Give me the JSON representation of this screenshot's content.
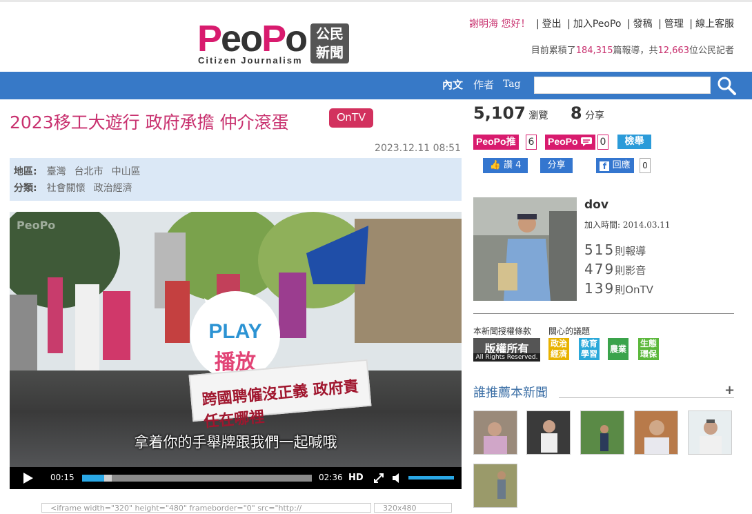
{
  "header": {
    "logo_word": "PeoPo",
    "logo_box_line1": "公民",
    "logo_box_line2": "新聞",
    "logo_sub": "Citizen Journalism",
    "greeting": "謝明海 您好！",
    "nav": [
      "登出",
      "加入PeoPo",
      "發稿",
      "管理",
      "線上客服"
    ],
    "stats_prefix": "目前累積了",
    "stats_reports": "184,315",
    "stats_mid": "篇報導，共",
    "stats_reporters": "12,663",
    "stats_suffix": "位公民記者"
  },
  "searchbar": {
    "tabs": [
      "內文",
      "作者",
      "Tag"
    ],
    "placeholder": ""
  },
  "article": {
    "title": "2023移工大遊行 政府承擔 仲介滾蛋",
    "badge": "OnTV",
    "date": "2023.12.11 08:51",
    "location_label": "地區:",
    "location": [
      "臺灣",
      "台北市",
      "中山區"
    ],
    "category_label": "分類:",
    "category": [
      "社會關懷",
      "政治經濟"
    ]
  },
  "video": {
    "watermark": "PeoPo",
    "play_en": "PLAY",
    "play_zh": "播放",
    "banner_text": "跨國聘僱沒正義 政府責任在哪裡",
    "subtitle": "拿着你的手舉牌跟我們一起喊哦",
    "current_time": "00:15",
    "duration": "02:36",
    "progress": 0.096,
    "buffered": 0.13,
    "hd_label": "HD",
    "volume": 1.0
  },
  "embed": {
    "code": "<iframe width=\"320\" height=\"480\" frameborder=\"0\" src=\"http://",
    "size": "320x480"
  },
  "sidebar": {
    "views": "5,107",
    "views_label": "瀏覽",
    "shares": "8",
    "shares_label": "分享",
    "push_label": "PeoPo推",
    "push_count": "6",
    "comment_label": "PeoPo",
    "comment_count": "0",
    "report_label": "檢舉",
    "like_label": "讚 4",
    "share_label": "分享",
    "fb_label": "回應",
    "fb_count": "0",
    "author": {
      "name": "dov",
      "joined": "加入時間: 2014.03.11",
      "reports": "515",
      "reports_label": "則報導",
      "videos": "479",
      "videos_label": "則影音",
      "ontv": "139",
      "ontv_label": "則OnTV"
    },
    "license_title": "本新聞授權條款",
    "topics_title": "關心的議題",
    "copyright_line1": "版權所有",
    "copyright_line2": "All Rights Reserved.",
    "topics": [
      {
        "label": "政治經濟",
        "color": "#e8b200"
      },
      {
        "label": "教育學習",
        "color": "#2aa8d9"
      },
      {
        "label": "農業",
        "color": "#3aa34b"
      },
      {
        "label": "生態環保",
        "color": "#5cb83c"
      }
    ],
    "recommend_title": "誰推薦本新聞",
    "recommend_more": "+"
  }
}
